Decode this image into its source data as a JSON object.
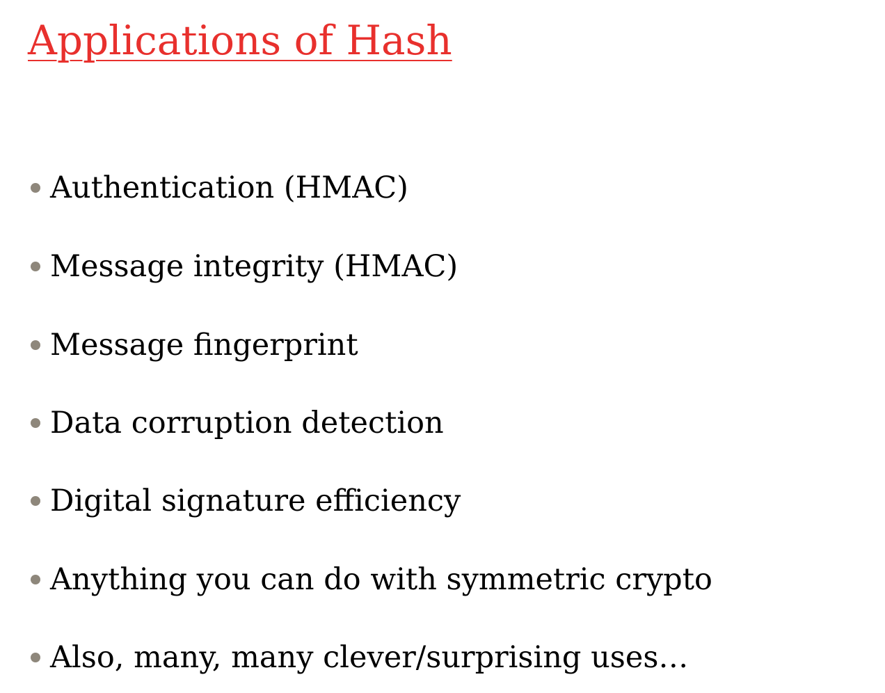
{
  "slide": {
    "title": "Applications of Hash",
    "bullets": [
      "Authentication (HMAC)",
      "Message integrity (HMAC)",
      "Message fingerprint",
      "Data corruption detection",
      "Digital signature efficiency",
      "Anything you can do with symmetric crypto",
      "Also, many, many clever/surprising uses…"
    ]
  },
  "colors": {
    "title": "#e8302d",
    "bullet_dot": "#8e877b",
    "text": "#000000",
    "background": "#ffffff"
  }
}
